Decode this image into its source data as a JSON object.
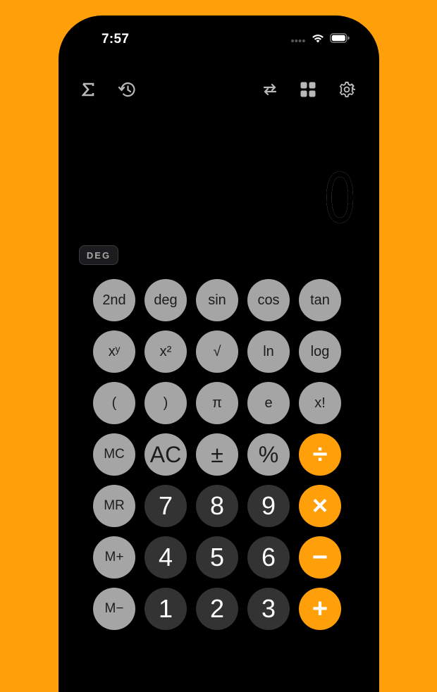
{
  "status_bar": {
    "time": "7:57"
  },
  "toolbar": {
    "left_icons": [
      "sigma-icon",
      "history-icon"
    ],
    "right_icons": [
      "swap-icon",
      "grid-icon",
      "gear-icon"
    ]
  },
  "display": {
    "value": "0"
  },
  "mode_badge": "DEG",
  "keys": [
    [
      "2nd",
      "deg",
      "sin",
      "cos",
      "tan"
    ],
    [
      "xʸ",
      "x²",
      "√",
      "ln",
      "log"
    ],
    [
      "(",
      ")",
      "π",
      "e",
      "x!"
    ],
    [
      "MC",
      "AC",
      "±",
      "%",
      "÷"
    ],
    [
      "MR",
      "7",
      "8",
      "9",
      "×"
    ],
    [
      "M+",
      "4",
      "5",
      "6",
      "−"
    ],
    [
      "M−",
      "1",
      "2",
      "3",
      "+"
    ]
  ],
  "colors": {
    "background": "#FF9F0A",
    "function_key": "#A5A5A5",
    "number_key": "#333333",
    "operator_key": "#FF9F0A"
  }
}
